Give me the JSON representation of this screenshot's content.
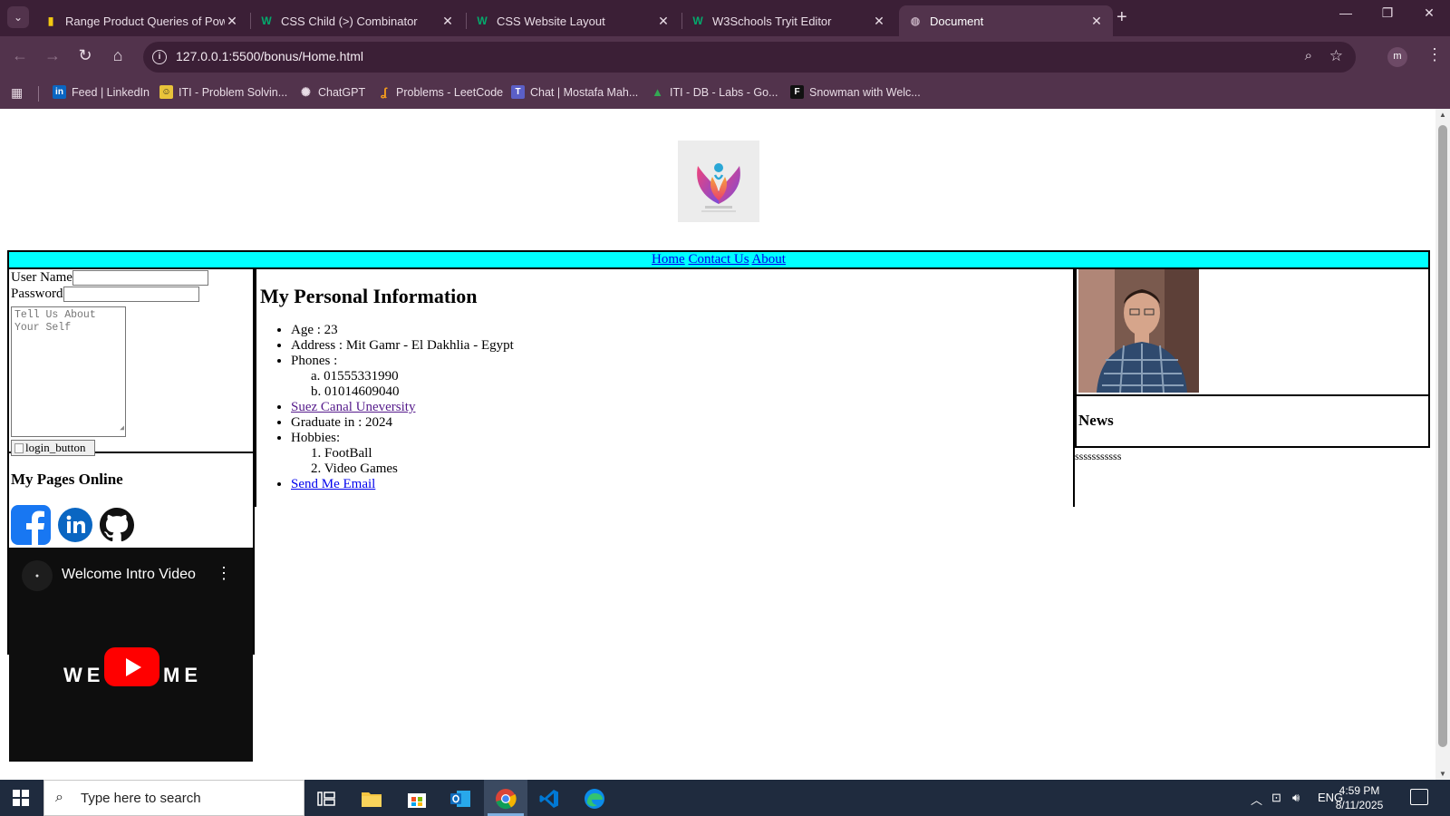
{
  "browser": {
    "tabs": [
      {
        "title": "Range Product Queries of Powe",
        "icon": "powerbi-icon"
      },
      {
        "title": "CSS Child (>) Combinator",
        "icon": "w3schools-icon"
      },
      {
        "title": "CSS Website Layout",
        "icon": "w3schools-icon"
      },
      {
        "title": "W3Schools Tryit Editor",
        "icon": "w3schools-icon"
      },
      {
        "title": "Document",
        "icon": "globe-icon",
        "active": true
      }
    ],
    "url": "127.0.0.1:5500/bonus/Home.html",
    "profile_initial": "m",
    "bookmarks": [
      {
        "label": "Feed | LinkedIn"
      },
      {
        "label": "ITI - Problem Solvin..."
      },
      {
        "label": "ChatGPT"
      },
      {
        "label": "Problems - LeetCode"
      },
      {
        "label": "Chat | Mostafa Mah..."
      },
      {
        "label": "ITI - DB - Labs - Go..."
      },
      {
        "label": "Snowman with Welc..."
      }
    ]
  },
  "page": {
    "nav": {
      "home": "Home",
      "contact": "Contact Us",
      "about": "About"
    },
    "login": {
      "username_label": "User Name",
      "password_label": "Password",
      "about_placeholder": "Tell Us About Your Self",
      "login_button_alt": "login_button"
    },
    "pages_title": "My Pages Online",
    "video": {
      "title": "Welcome Intro Video",
      "overlay_left": "WE",
      "overlay_right": "ME"
    },
    "info": {
      "heading": "My Personal Information",
      "age": "Age : 23",
      "address": "Address : Mit Gamr - El Dakhlia - Egypt",
      "phones_label": "Phones :",
      "phones": [
        "a. 01555331990",
        "b. 01014609040"
      ],
      "university": "Suez Canal Uneversity",
      "graduate": "Graduate in : 2024",
      "hobbies_label": "Hobbies:",
      "hobbies": [
        "1. FootBall",
        "2. Video Games"
      ],
      "email_link": "Send Me Email"
    },
    "news": {
      "heading": "News",
      "text": "sssssssssss"
    }
  },
  "taskbar": {
    "search_placeholder": "Type here to search",
    "language": "ENG",
    "time": "4:59 PM",
    "date": "8/11/2025"
  },
  "colors": {
    "nav_bg": "#00ffff",
    "chrome_dark": "#3b1f36",
    "chrome": "#52334c",
    "taskbar": "#1f2b3e"
  }
}
